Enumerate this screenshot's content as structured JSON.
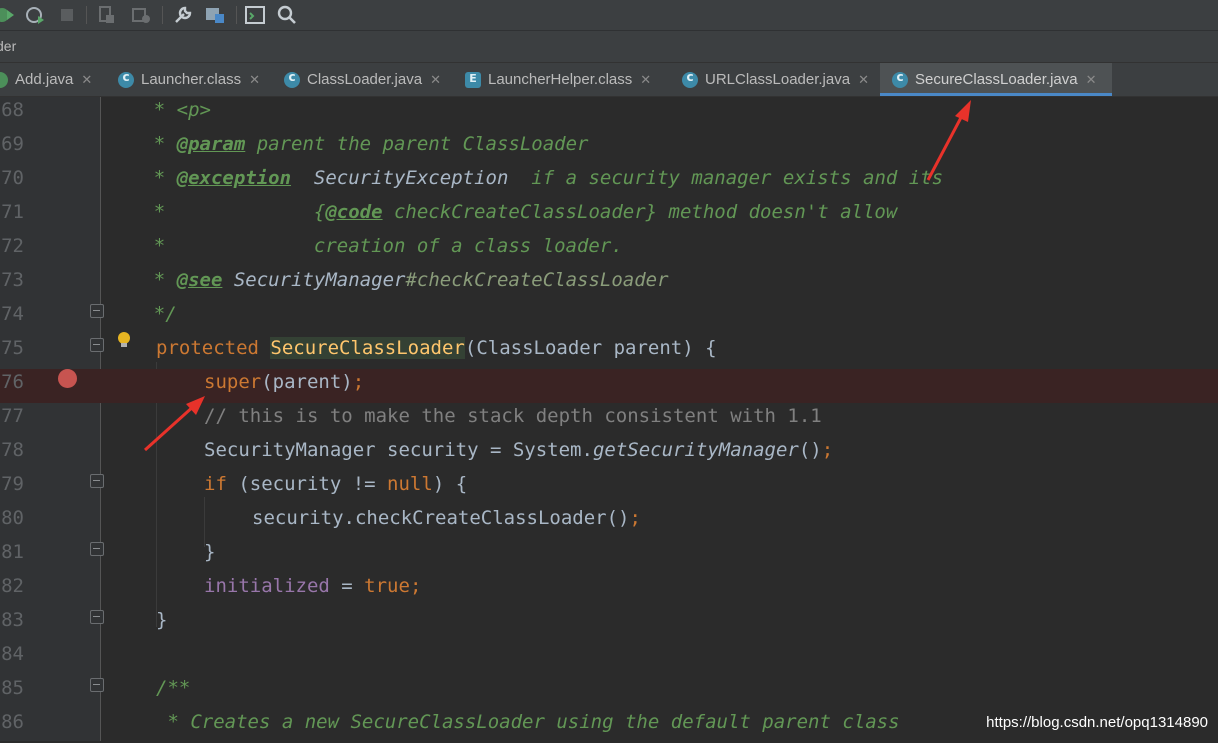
{
  "toolbar": {
    "icons": [
      "run-icon",
      "debug-icon",
      "stop-icon",
      "build-icon",
      "rebuild-icon",
      "settings-icon",
      "project-structure-icon",
      "terminal-icon",
      "search-icon"
    ]
  },
  "breadcrumb": {
    "text": "der"
  },
  "tabs": [
    {
      "label": "Add.java",
      "close": "✕"
    },
    {
      "label": "Launcher.class",
      "close": "✕"
    },
    {
      "label": "ClassLoader.java",
      "close": "✕"
    },
    {
      "label": "LauncherHelper.class",
      "close": "✕"
    },
    {
      "label": "URLClassLoader.java",
      "close": "✕"
    },
    {
      "label": "SecureClassLoader.java",
      "close": "✕"
    }
  ],
  "editor": {
    "lines": [
      {
        "num": "68"
      },
      {
        "num": "69"
      },
      {
        "num": "70"
      },
      {
        "num": "71"
      },
      {
        "num": "72"
      },
      {
        "num": "73"
      },
      {
        "num": "74"
      },
      {
        "num": "75"
      },
      {
        "num": "76"
      },
      {
        "num": "77"
      },
      {
        "num": "78"
      },
      {
        "num": "79"
      },
      {
        "num": "80"
      },
      {
        "num": "81"
      },
      {
        "num": "82"
      },
      {
        "num": "83"
      },
      {
        "num": "84"
      },
      {
        "num": "85"
      },
      {
        "num": "86"
      }
    ],
    "code": {
      "l68": {
        "a": "    * ",
        "b": "<p>"
      },
      "l69": {
        "a": "    * ",
        "t": "@param",
        "b": " parent the parent ClassLoader"
      },
      "l70": {
        "a": "    * ",
        "t": "@exception",
        "b": "  ",
        "r": "SecurityException",
        "c": "  if a security manager exists and its"
      },
      "l71": {
        "a": "    *             {",
        "t": "@code",
        "b": " checkCreateClassLoader} method doesn't allow"
      },
      "l72": {
        "a": "    *             creation of a class loader."
      },
      "l73": {
        "a": "    * ",
        "t": "@see",
        "b": " ",
        "r": "SecurityManager",
        "c": "#checkCreateClassLoader"
      },
      "l74": {
        "a": "    */"
      },
      "l75": {
        "kw": "protected",
        "sp": " ",
        "ctor": "SecureClassLoader",
        "rest": "(ClassLoader parent) {"
      },
      "l76": {
        "kw": "super",
        "rest": "(parent)",
        "semi": ";"
      },
      "l77": {
        "cmt": "// this is to make the stack depth consistent with 1.1"
      },
      "l78": {
        "a": "SecurityManager security = System.",
        "m": "getSecurityManager",
        "b": "()",
        "semi": ";"
      },
      "l79": {
        "kw": "if",
        "a": " (security != ",
        "kw2": "null",
        "b": ") {"
      },
      "l80": {
        "a": "security.checkCreateClassLoader()",
        "semi": ";"
      },
      "l81": {
        "a": "}"
      },
      "l82": {
        "fld": "initialized",
        "a": " = ",
        "kw": "true",
        "semi": ";"
      },
      "l83": {
        "a": "}"
      },
      "l84": {
        "a": ""
      },
      "l85": {
        "a": "/**"
      },
      "l86": {
        "a": " * Creates a new SecureClassLoader using the default parent class"
      }
    }
  },
  "watermark": "https://blog.csdn.net/opq1314890"
}
